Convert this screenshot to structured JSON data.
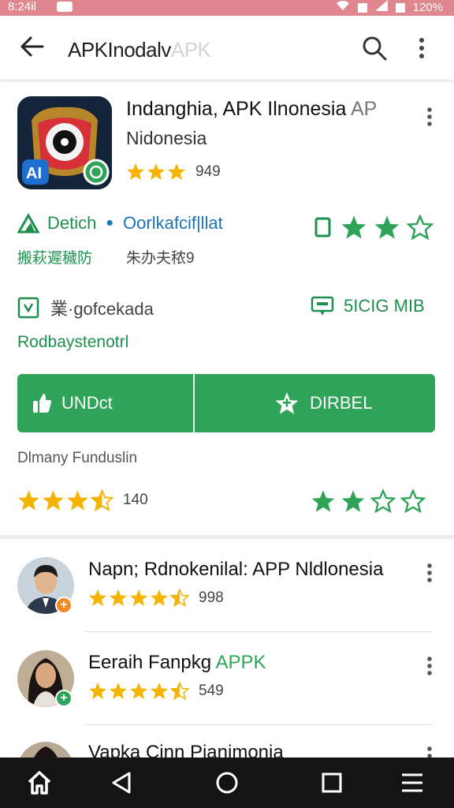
{
  "status_bar": {
    "time": "8:24il",
    "battery": "120%"
  },
  "app_bar": {
    "title": "APKInodalv",
    "title_faded": "APK"
  },
  "app": {
    "title": "Indanghia, APK Ilnonesia",
    "title_suffix": "AP",
    "subtitle": "Nidonesia",
    "rating_count": "949",
    "developer": "Detich",
    "developer_link": "Oorlkafcif|llat",
    "line_green": "搬萩遲穢防",
    "line_gray": "朱办夫秾9",
    "category": "業·gofcekada",
    "size": "5ICIG MIB",
    "read_more": "Rodbaystenotrl",
    "install_label": "UNDct",
    "wishlist_label": "DIRBEL",
    "tagline": "Dlmany Funduslin",
    "review_count": "140"
  },
  "list": [
    {
      "title": "Napn; Rdnokenilal: APP Nldlonesia",
      "title_green": "",
      "count": "998",
      "rating": 4.5,
      "badge": "+",
      "badge_color": "#f08a24"
    },
    {
      "title": "Eeraih Fanpkg ",
      "title_green": "APPK",
      "count": "549",
      "rating": 4.5,
      "badge": "+",
      "badge_color": "#2fa458"
    },
    {
      "title": "Vapka Cinn Pianimonia",
      "title_green": "",
      "count": "",
      "rating": 0,
      "badge": "",
      "badge_color": ""
    }
  ],
  "colors": {
    "accent": "#2fa458",
    "status_bar": "#e0868f",
    "star": "#f5b400",
    "link": "#1a73b6"
  }
}
